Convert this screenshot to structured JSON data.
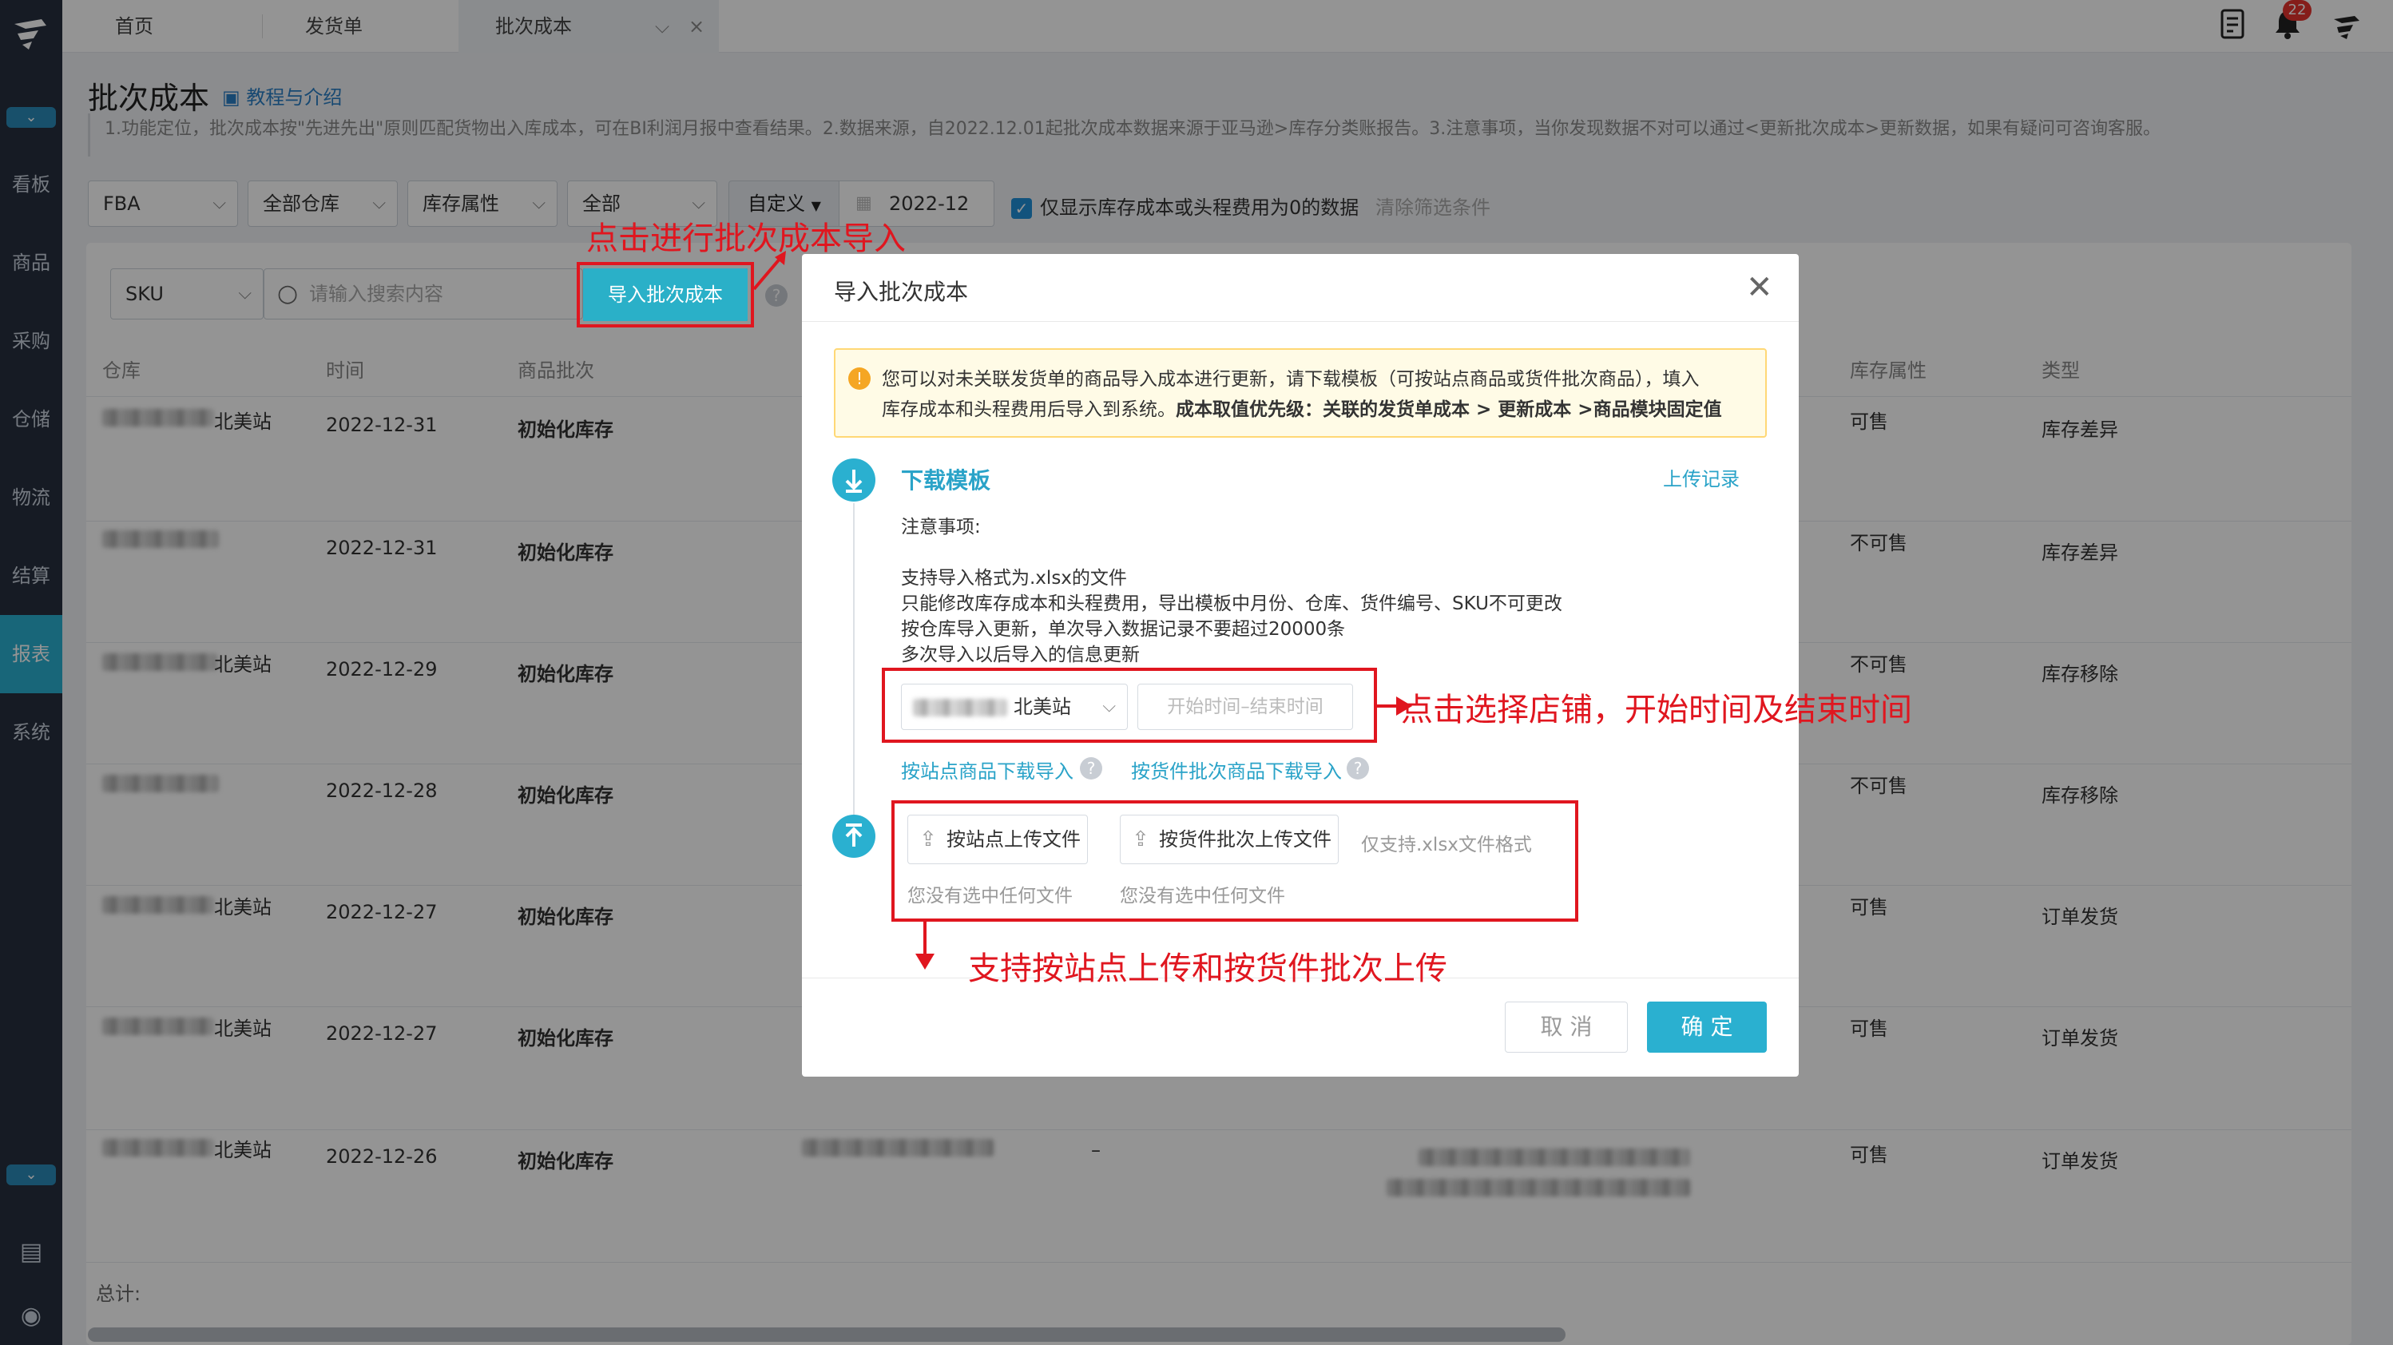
{
  "sidebar": {
    "items": [
      {
        "label": "看板"
      },
      {
        "label": "商品"
      },
      {
        "label": "采购"
      },
      {
        "label": "仓储"
      },
      {
        "label": "物流"
      },
      {
        "label": "结算"
      },
      {
        "label": "报表"
      },
      {
        "label": "系统"
      }
    ],
    "active": "报表"
  },
  "topbar": {
    "tabs": [
      {
        "label": "首页"
      },
      {
        "label": "发货单"
      },
      {
        "label": "批次成本"
      }
    ],
    "notification_count": "22"
  },
  "page": {
    "title": "批次成本",
    "tutorial_link": "教程与介绍",
    "description": "1.功能定位，批次成本按\"先进先出\"原则匹配货物出入库成本，可在BI利润月报中查看结果。2.数据来源，自2022.12.01起批次成本数据来源于亚马逊>库存分类账报告。3.注意事项，当你发现数据不对可以通过<更新批次成本>更新数据，如果有疑问可咨询客服。"
  },
  "filters": {
    "type": "FBA",
    "warehouse": "全部仓库",
    "inventory_attr": "库存属性",
    "all": "全部",
    "custom": "自定义",
    "date": "2022-12",
    "checkbox_label": "仅显示库存成本或头程费用为0的数据",
    "clear": "清除筛选条件"
  },
  "search": {
    "field": "SKU",
    "placeholder": "请输入搜索内容",
    "import_button": "导入批次成本"
  },
  "table": {
    "headers": {
      "warehouse": "仓库",
      "time": "时间",
      "batch": "商品批次",
      "inventory_attr": "库存属性",
      "type": "类型"
    },
    "rows": [
      {
        "warehouse": "北美站",
        "time": "2022-12-31",
        "batch": "初始化库存",
        "attr": "可售",
        "type": "库存差异"
      },
      {
        "warehouse": "",
        "time": "2022-12-31",
        "batch": "初始化库存",
        "attr": "不可售",
        "type": "库存差异"
      },
      {
        "warehouse": "北美站",
        "time": "2022-12-29",
        "batch": "初始化库存",
        "attr": "不可售",
        "type": "库存移除"
      },
      {
        "warehouse": "",
        "time": "2022-12-28",
        "batch": "初始化库存",
        "attr": "不可售",
        "type": "库存移除"
      },
      {
        "warehouse": "北美站",
        "time": "2022-12-27",
        "batch": "初始化库存",
        "attr": "可售",
        "type": "订单发货"
      },
      {
        "warehouse": "北美站",
        "time": "2022-12-27",
        "batch": "初始化库存",
        "attr": "可售",
        "type": "订单发货"
      },
      {
        "warehouse": "北美站",
        "time": "2022-12-26",
        "batch": "初始化库存",
        "attr": "可售",
        "type": "订单发货"
      }
    ],
    "dash": "–",
    "total_label": "总计:"
  },
  "modal": {
    "title": "导入批次成本",
    "notice_line1": "您可以对未关联发货单的商品导入成本进行更新，请下载模板（可按站点商品或货件批次商品），填入",
    "notice_line2_plain": "库存成本和头程费用后导入到系统。",
    "notice_line2_bold": "成本取值优先级：关联的发货单成本 > 更新成本 >商品模块固定值",
    "step1_title": "下载模板",
    "upload_history": "上传记录",
    "notes_title": "注意事项:",
    "notes": [
      "支持导入格式为.xlsx的文件",
      "只能修改库存成本和头程费用，导出模板中月份、仓库、货件编号、SKU不可更改",
      "按仓库导入更新，单次导入数据记录不要超过20000条",
      "多次导入以后导入的信息更新"
    ],
    "store_select": "北美站",
    "date_placeholder": "开始时间–结束时间",
    "download_by_site": "按站点商品下载导入",
    "download_by_shipment": "按货件批次商品下载导入",
    "upload_by_site": "按站点上传文件",
    "upload_by_shipment": "按货件批次上传文件",
    "format_hint": "仅支持.xlsx文件格式",
    "no_file_1": "您没有选中任何文件",
    "no_file_2": "您没有选中任何文件",
    "cancel": "取 消",
    "confirm": "确 定"
  },
  "annotations": {
    "click_import": "点击进行批次成本导入",
    "select_store": "点击选择店铺，开始时间及结束时间",
    "upload_support": "支持按站点上传和按货件批次上传"
  },
  "colors": {
    "accent": "#2ab0d0",
    "sidebar_bg": "#26303e",
    "annotation_red": "#e0161f"
  }
}
